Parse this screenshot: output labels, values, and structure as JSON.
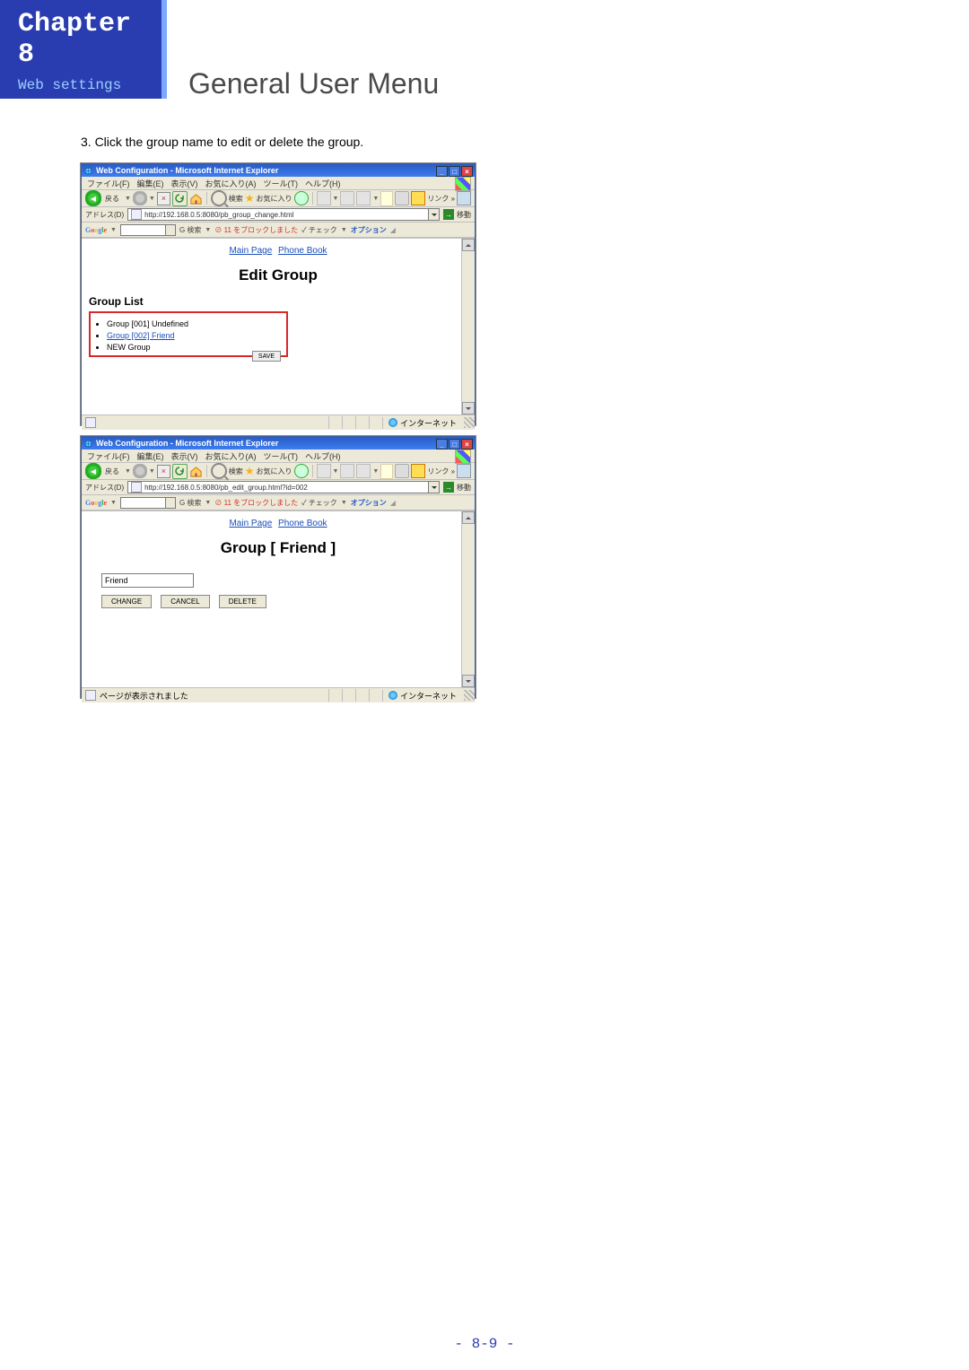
{
  "header": {
    "chapter": "Chapter 8",
    "sub": "Web settings",
    "title": "General User Menu"
  },
  "instruction": "3. Click the group name to edit or delete the group.",
  "ie_common": {
    "window_title": "Web Configuration - Microsoft Internet Explorer",
    "menus": {
      "file": "ファイル(F)",
      "edit": "編集(E)",
      "view": "表示(V)",
      "fav": "お気に入り(A)",
      "tools": "ツール(T)",
      "help": "ヘルプ(H)"
    },
    "toolbar": {
      "back": "戻る",
      "search": "検索",
      "favorites": "お気に入り",
      "links": "リンク"
    },
    "addr_label": "アドレス(D)",
    "go": "移動",
    "google": {
      "logo": "Google",
      "search": "検索",
      "blocked": "11 をブロックしました",
      "check": "チェック",
      "options": "オプション"
    },
    "nav": {
      "main": "Main Page",
      "pb": "Phone Book"
    }
  },
  "win1": {
    "url": "http://192.168.0.5:8080/pb_group_change.html",
    "heading": "Edit Group",
    "list_label": "Group List",
    "items": {
      "g1": "Group [001] Undefined",
      "g2": "Group [002] Friend",
      "newrow": "NEW Group"
    },
    "save": "SAVE",
    "status_left": "",
    "zone": "インターネット"
  },
  "win2": {
    "url": "http://192.168.0.5:8080/pb_edit_group.html?id=002",
    "heading": "Group [ Friend ]",
    "input_value": "Friend",
    "buttons": {
      "change": "CHANGE",
      "cancel": "CANCEL",
      "delete": "DELETE"
    },
    "status_left": "ページが表示されました",
    "zone": "インターネット"
  },
  "footer": "- 8-9 -"
}
